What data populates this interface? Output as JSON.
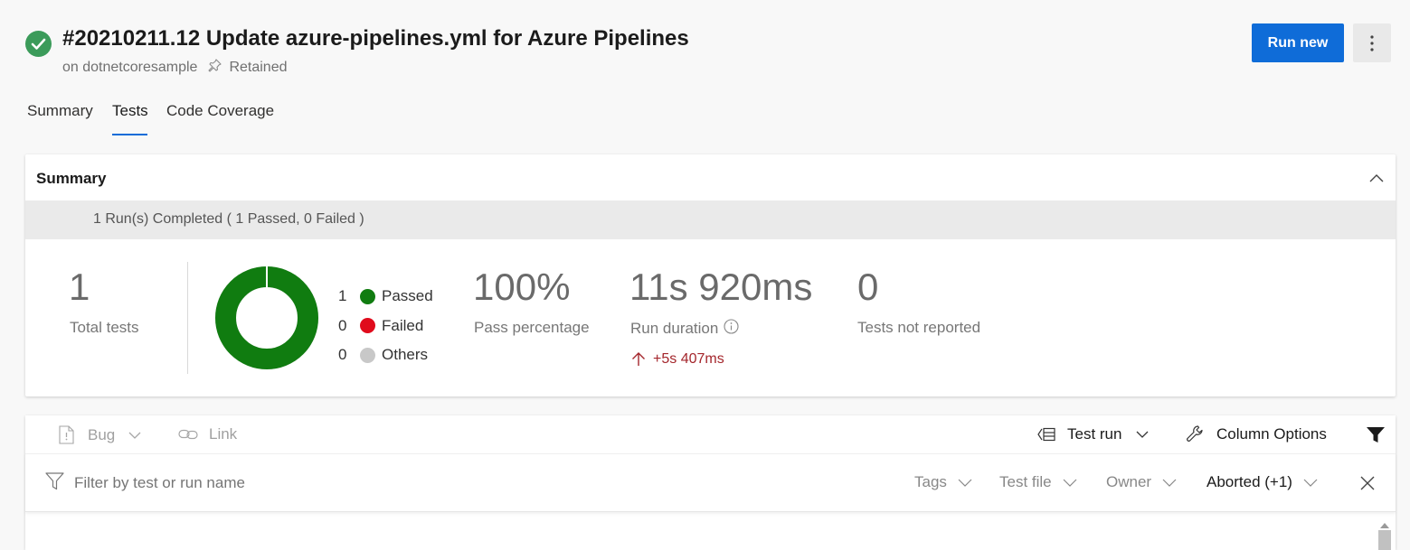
{
  "header": {
    "title": "#20210211.12 Update azure-pipelines.yml for Azure Pipelines",
    "repo": "on dotnetcoresample",
    "retained": "Retained",
    "run_new_label": "Run new",
    "status_color": "#3b9b5a",
    "accent_color": "#0f6cd8"
  },
  "tabs": [
    "Summary",
    "Tests",
    "Code Coverage"
  ],
  "summary": {
    "title": "Summary",
    "banner": "1 Run(s) Completed ( 1 Passed, 0 Failed )",
    "total_tests": "1",
    "total_tests_label": "Total tests",
    "legend": [
      {
        "count": "1",
        "label": "Passed",
        "color": "#107c10"
      },
      {
        "count": "0",
        "label": "Failed",
        "color": "#e00b1c"
      },
      {
        "count": "0",
        "label": "Others",
        "color": "#c8c8c8"
      }
    ],
    "pass_pct": "100%",
    "pass_pct_label": "Pass percentage",
    "duration": "11s 920ms",
    "duration_label": "Run duration",
    "duration_delta": "+5s 407ms",
    "not_reported": "0",
    "not_reported_label": "Tests not reported",
    "donut_pass_fraction": 1.0
  },
  "toolbar": {
    "bug_label": "Bug",
    "link_label": "Link",
    "test_run_label": "Test run",
    "column_options_label": "Column Options"
  },
  "filters": {
    "search_placeholder": "Filter by test or run name",
    "tags": "Tags",
    "test_file": "Test file",
    "owner": "Owner",
    "outcome": "Aborted (+1)"
  }
}
